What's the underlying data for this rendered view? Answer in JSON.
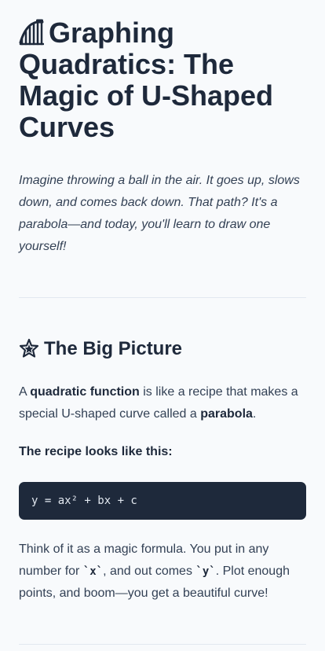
{
  "header": {
    "emoji_icon": "roller-coaster-icon",
    "title": "Graphing Quadratics: The Magic of U-Shaped Curves"
  },
  "intro": "Imagine throwing a ball in the air. It goes up, slows down, and comes back down. That path? It's a parabola—and today, you'll learn to draw one yourself!",
  "section": {
    "emoji_icon": "glowing-star-icon",
    "title": "The Big Picture",
    "para1": {
      "part1": "A ",
      "bold1": "quadratic function",
      "part2": " is like a recipe that makes a special U-shaped curve called a ",
      "bold2": "parabola",
      "part3": "."
    },
    "recipe_label": "The recipe looks like this:",
    "code": "y = ax² + bx + c",
    "para2": {
      "part1": "Think of it as a magic formula. You put in any number for ",
      "code1": "`x`",
      "part2": ", and out comes ",
      "code2": "`y`",
      "part3": ". Plot enough points, and boom—you get a beautiful curve!"
    }
  },
  "colors": {
    "background": "#f8fafc",
    "text": "#1e293b",
    "code_background": "#1e293b",
    "divider": "#e2e8f0"
  }
}
